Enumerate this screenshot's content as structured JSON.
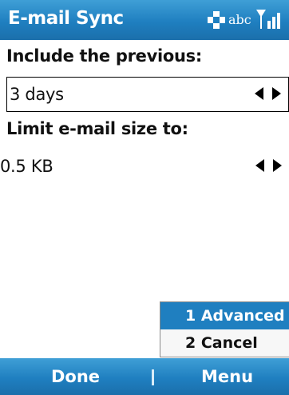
{
  "titlebar": {
    "title": "E-mail Sync",
    "input_mode": "abc",
    "icons": [
      "dpad-icon",
      "signal-icon"
    ]
  },
  "fields": [
    {
      "label": "Include the previous:",
      "value": "3 days",
      "focused": true
    },
    {
      "label": "Limit e-mail size to:",
      "value": "0.5 KB",
      "focused": false
    }
  ],
  "menu": {
    "items": [
      {
        "label": "1 Advanced",
        "selected": true
      },
      {
        "label": "2 Cancel",
        "selected": false
      }
    ]
  },
  "softkeys": {
    "left": "Done",
    "right": "Menu"
  },
  "colors": {
    "bar": "#1f7fc0",
    "selection": "#1f7fc0"
  }
}
